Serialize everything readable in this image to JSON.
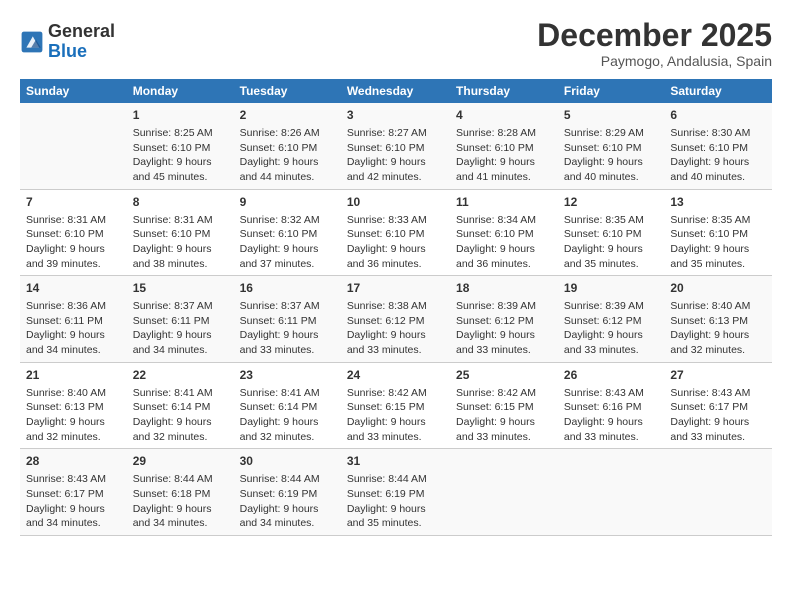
{
  "header": {
    "logo_line1": "General",
    "logo_line2": "Blue",
    "month": "December 2025",
    "location": "Paymogo, Andalusia, Spain"
  },
  "weekdays": [
    "Sunday",
    "Monday",
    "Tuesday",
    "Wednesday",
    "Thursday",
    "Friday",
    "Saturday"
  ],
  "weeks": [
    [
      {
        "day": "",
        "info": ""
      },
      {
        "day": "1",
        "info": "Sunrise: 8:25 AM\nSunset: 6:10 PM\nDaylight: 9 hours\nand 45 minutes."
      },
      {
        "day": "2",
        "info": "Sunrise: 8:26 AM\nSunset: 6:10 PM\nDaylight: 9 hours\nand 44 minutes."
      },
      {
        "day": "3",
        "info": "Sunrise: 8:27 AM\nSunset: 6:10 PM\nDaylight: 9 hours\nand 42 minutes."
      },
      {
        "day": "4",
        "info": "Sunrise: 8:28 AM\nSunset: 6:10 PM\nDaylight: 9 hours\nand 41 minutes."
      },
      {
        "day": "5",
        "info": "Sunrise: 8:29 AM\nSunset: 6:10 PM\nDaylight: 9 hours\nand 40 minutes."
      },
      {
        "day": "6",
        "info": "Sunrise: 8:30 AM\nSunset: 6:10 PM\nDaylight: 9 hours\nand 40 minutes."
      }
    ],
    [
      {
        "day": "7",
        "info": "Sunrise: 8:31 AM\nSunset: 6:10 PM\nDaylight: 9 hours\nand 39 minutes."
      },
      {
        "day": "8",
        "info": "Sunrise: 8:31 AM\nSunset: 6:10 PM\nDaylight: 9 hours\nand 38 minutes."
      },
      {
        "day": "9",
        "info": "Sunrise: 8:32 AM\nSunset: 6:10 PM\nDaylight: 9 hours\nand 37 minutes."
      },
      {
        "day": "10",
        "info": "Sunrise: 8:33 AM\nSunset: 6:10 PM\nDaylight: 9 hours\nand 36 minutes."
      },
      {
        "day": "11",
        "info": "Sunrise: 8:34 AM\nSunset: 6:10 PM\nDaylight: 9 hours\nand 36 minutes."
      },
      {
        "day": "12",
        "info": "Sunrise: 8:35 AM\nSunset: 6:10 PM\nDaylight: 9 hours\nand 35 minutes."
      },
      {
        "day": "13",
        "info": "Sunrise: 8:35 AM\nSunset: 6:10 PM\nDaylight: 9 hours\nand 35 minutes."
      }
    ],
    [
      {
        "day": "14",
        "info": "Sunrise: 8:36 AM\nSunset: 6:11 PM\nDaylight: 9 hours\nand 34 minutes."
      },
      {
        "day": "15",
        "info": "Sunrise: 8:37 AM\nSunset: 6:11 PM\nDaylight: 9 hours\nand 34 minutes."
      },
      {
        "day": "16",
        "info": "Sunrise: 8:37 AM\nSunset: 6:11 PM\nDaylight: 9 hours\nand 33 minutes."
      },
      {
        "day": "17",
        "info": "Sunrise: 8:38 AM\nSunset: 6:12 PM\nDaylight: 9 hours\nand 33 minutes."
      },
      {
        "day": "18",
        "info": "Sunrise: 8:39 AM\nSunset: 6:12 PM\nDaylight: 9 hours\nand 33 minutes."
      },
      {
        "day": "19",
        "info": "Sunrise: 8:39 AM\nSunset: 6:12 PM\nDaylight: 9 hours\nand 33 minutes."
      },
      {
        "day": "20",
        "info": "Sunrise: 8:40 AM\nSunset: 6:13 PM\nDaylight: 9 hours\nand 32 minutes."
      }
    ],
    [
      {
        "day": "21",
        "info": "Sunrise: 8:40 AM\nSunset: 6:13 PM\nDaylight: 9 hours\nand 32 minutes."
      },
      {
        "day": "22",
        "info": "Sunrise: 8:41 AM\nSunset: 6:14 PM\nDaylight: 9 hours\nand 32 minutes."
      },
      {
        "day": "23",
        "info": "Sunrise: 8:41 AM\nSunset: 6:14 PM\nDaylight: 9 hours\nand 32 minutes."
      },
      {
        "day": "24",
        "info": "Sunrise: 8:42 AM\nSunset: 6:15 PM\nDaylight: 9 hours\nand 33 minutes."
      },
      {
        "day": "25",
        "info": "Sunrise: 8:42 AM\nSunset: 6:15 PM\nDaylight: 9 hours\nand 33 minutes."
      },
      {
        "day": "26",
        "info": "Sunrise: 8:43 AM\nSunset: 6:16 PM\nDaylight: 9 hours\nand 33 minutes."
      },
      {
        "day": "27",
        "info": "Sunrise: 8:43 AM\nSunset: 6:17 PM\nDaylight: 9 hours\nand 33 minutes."
      }
    ],
    [
      {
        "day": "28",
        "info": "Sunrise: 8:43 AM\nSunset: 6:17 PM\nDaylight: 9 hours\nand 34 minutes."
      },
      {
        "day": "29",
        "info": "Sunrise: 8:44 AM\nSunset: 6:18 PM\nDaylight: 9 hours\nand 34 minutes."
      },
      {
        "day": "30",
        "info": "Sunrise: 8:44 AM\nSunset: 6:19 PM\nDaylight: 9 hours\nand 34 minutes."
      },
      {
        "day": "31",
        "info": "Sunrise: 8:44 AM\nSunset: 6:19 PM\nDaylight: 9 hours\nand 35 minutes."
      },
      {
        "day": "",
        "info": ""
      },
      {
        "day": "",
        "info": ""
      },
      {
        "day": "",
        "info": ""
      }
    ]
  ]
}
